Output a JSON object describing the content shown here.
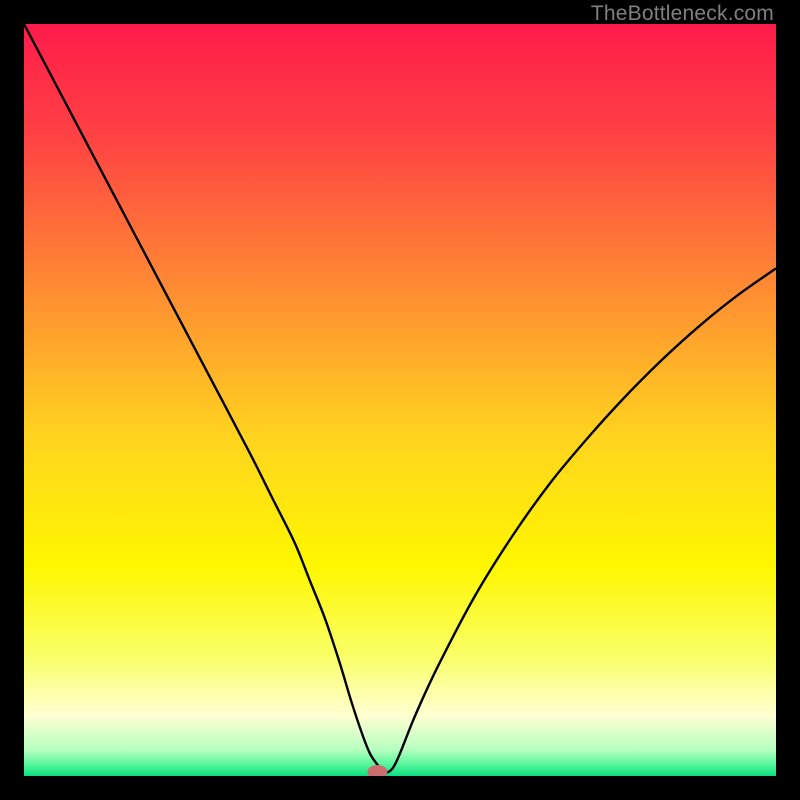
{
  "watermark": {
    "text": "TheBottleneck.com"
  },
  "chart_data": {
    "type": "line",
    "title": "",
    "xlabel": "",
    "ylabel": "",
    "xlim": [
      0,
      100
    ],
    "ylim": [
      0,
      100
    ],
    "series": [
      {
        "name": "bottleneck-curve",
        "x": [
          0,
          5,
          10,
          15,
          20,
          25,
          30,
          33,
          36,
          38,
          40,
          42,
          43.5,
          45,
          46,
          47,
          48,
          49,
          50,
          52,
          55,
          60,
          65,
          70,
          75,
          80,
          85,
          90,
          95,
          100
        ],
        "y": [
          100,
          90.5,
          81,
          71.5,
          62,
          52.5,
          43,
          37,
          31,
          26,
          21,
          15,
          10,
          5.5,
          3,
          1.5,
          0.5,
          1,
          3,
          8,
          14.5,
          24,
          32,
          39,
          45,
          50.5,
          55.5,
          60,
          64,
          67.5
        ]
      }
    ],
    "marker": {
      "x": 47,
      "y": 0
    },
    "gradient_stops": [
      {
        "offset": 0,
        "color": "#ff1b4b"
      },
      {
        "offset": 0.15,
        "color": "#ff4244"
      },
      {
        "offset": 0.35,
        "color": "#ff8b33"
      },
      {
        "offset": 0.55,
        "color": "#ffd41f"
      },
      {
        "offset": 0.72,
        "color": "#fff700"
      },
      {
        "offset": 0.84,
        "color": "#f9ff66"
      },
      {
        "offset": 0.92,
        "color": "#ffffd2"
      },
      {
        "offset": 0.965,
        "color": "#b6ffc0"
      },
      {
        "offset": 0.985,
        "color": "#55f59a"
      },
      {
        "offset": 1.0,
        "color": "#09e081"
      }
    ]
  }
}
